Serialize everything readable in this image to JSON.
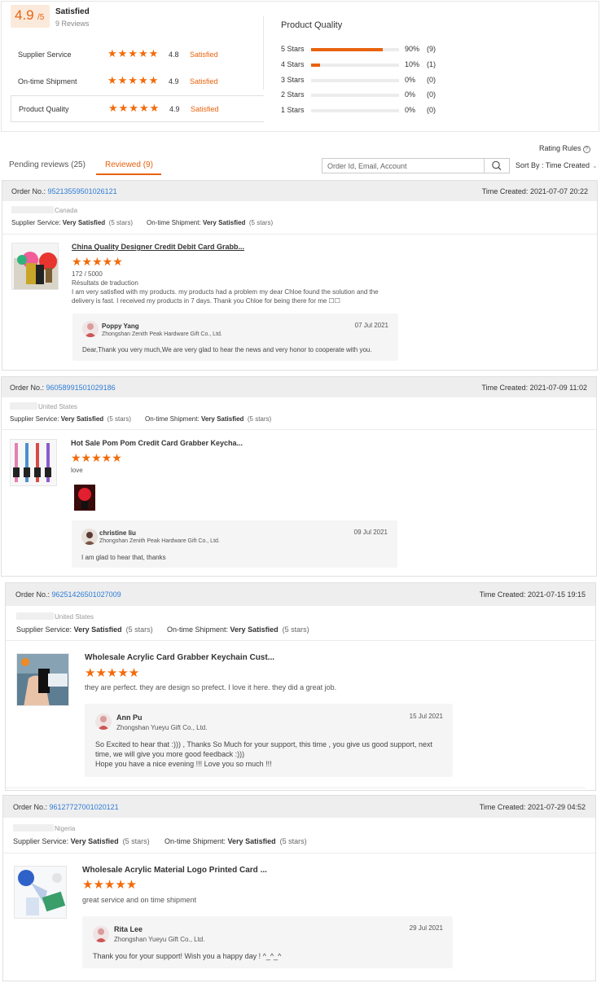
{
  "summary": {
    "score": "4.9",
    "score_suffix": "/5",
    "status": "Satisfied",
    "reviews_count": "9 Reviews",
    "criteria": [
      {
        "label": "Supplier Service",
        "score": "4.8",
        "status": "Satisfied",
        "stars": 5
      },
      {
        "label": "On-time Shipment",
        "score": "4.9",
        "status": "Satisfied",
        "stars": 5
      },
      {
        "label": "Product Quality",
        "score": "4.9",
        "status": "Satisfied",
        "stars": 5
      }
    ],
    "product_quality": {
      "title": "Product Quality",
      "distribution": [
        {
          "label": "5 Stars",
          "percent": 90,
          "percent_text": "90%",
          "count": "(9)"
        },
        {
          "label": "4 Stars",
          "percent": 10,
          "percent_text": "10%",
          "count": "(1)"
        },
        {
          "label": "3 Stars",
          "percent": 0,
          "percent_text": "0%",
          "count": "(0)"
        },
        {
          "label": "2 Stars",
          "percent": 0,
          "percent_text": "0%",
          "count": "(0)"
        },
        {
          "label": "1 Stars",
          "percent": 0,
          "percent_text": "0%",
          "count": "(0)"
        }
      ]
    }
  },
  "toolbar": {
    "rating_rules": "Rating Rules",
    "tabs": [
      {
        "label": "Pending reviews (25)",
        "active": false
      },
      {
        "label": "Reviewed (9)",
        "active": true
      }
    ],
    "search_placeholder": "Order Id, Email, Account",
    "sort_label": "Sort By : Time Created"
  },
  "labels": {
    "order_no": "Order No.:",
    "time_created": "Time Created:",
    "supplier_service": "Supplier Service:",
    "ontime_shipment": "On-time Shipment:",
    "very_satisfied": "Very Satisfied",
    "five_stars": "(5 stars)"
  },
  "colors": {
    "accent": "#e8620d",
    "link": "#2d7bd6",
    "star": "#f26b0b"
  },
  "reviews": [
    {
      "order_no": "95213559501026121",
      "time_created": "2021-07-07 20:22",
      "country": "Canada",
      "product_title": "China Quality Designer Credit Debit Card Grabb...",
      "rating": 5,
      "char_count": "172 / 5000",
      "translation_label": "Résultats de traduction",
      "text": "I am very satisfied with my products. my products had a problem my dear Chloe found the solution and the delivery is fast. I received my products in 7 days. Thank you Chloe for being there for me ☐☐",
      "reply": {
        "name": "Poppy Yang",
        "company": "Zhongshan Zenith Peak Hardware Gift Co., Ltd.",
        "date": "07 Jul 2021",
        "text": "Dear,Thank you very much,We are very glad to hear the news and very honor to cooperate with you."
      }
    },
    {
      "order_no": "96058991501029186",
      "time_created": "2021-07-09 11:02",
      "country": "United States",
      "product_title": "Hot Sale Pom Pom Credit Card Grabber Keycha...",
      "rating": 5,
      "text": "love",
      "reply": {
        "name": "christine liu",
        "company": "Zhongshan Zenith Peak Hardware Gift Co., Ltd.",
        "date": "09 Jul 2021",
        "text": "I am glad to hear that, thanks"
      }
    },
    {
      "order_no": "96251426501027009",
      "time_created": "2021-07-15 19:15",
      "country": "United States",
      "product_title": "Wholesale Acrylic Card Grabber Keychain Cust...",
      "rating": 5,
      "text": "they are perfect. they are design so prefect. I love it here. they did a great job.",
      "reply": {
        "name": "Ann Pu",
        "company": "Zhongshan Yueyu Gift Co., Ltd.",
        "date": "15 Jul 2021",
        "text": "So Excited to hear that :))) , Thanks So Much for your support, this time , you give us good support, next time, we will give you more good feedback :)))\nHope you have a nice evening !!! Love you so much !!!"
      }
    },
    {
      "order_no": "96127727001020121",
      "time_created": "2021-07-29 04:52",
      "country": "Nigeria",
      "product_title": "Wholesale Acrylic Material Logo Printed Card ...",
      "rating": 5,
      "text": "great service and on time shipment",
      "reply": {
        "name": "Rita Lee",
        "company": "Zhongshan Yueyu Gift Co., Ltd.",
        "date": "29 Jul 2021",
        "text": "Thank you for your support!  Wish you a happy day !  ^_^_^"
      }
    }
  ]
}
